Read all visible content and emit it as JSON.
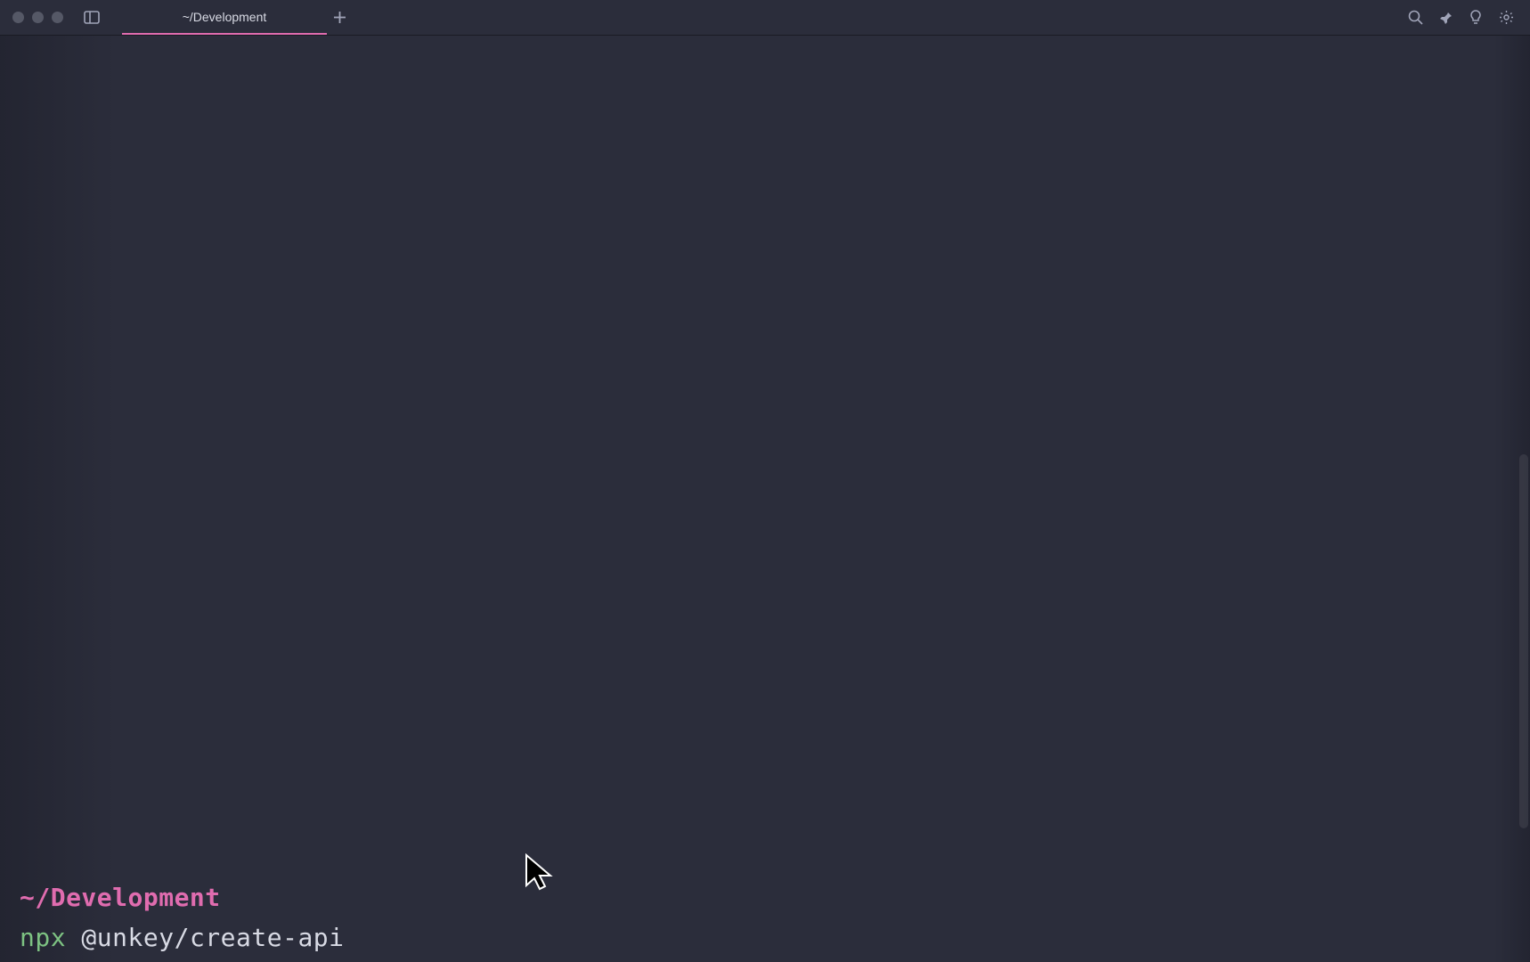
{
  "tabs": [
    {
      "title": "~/Development",
      "active": true
    }
  ],
  "terminal": {
    "cwd": "~/Development",
    "command_exec": "npx",
    "command_args": " @unkey/create-api"
  },
  "colors": {
    "accent": "#e06caf",
    "green": "#7dc282",
    "bg": "#2b2d3b"
  }
}
